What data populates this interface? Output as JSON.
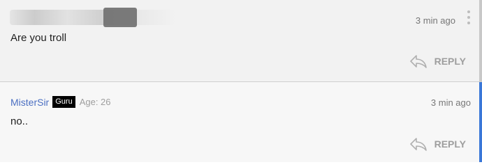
{
  "comments": [
    {
      "timestamp": "3 min ago",
      "text": "Are you troll",
      "reply_label": "REPLY",
      "icons": {
        "more": "more-vertical-icon",
        "reply": "reply-arrow-icon"
      }
    },
    {
      "username": "MisterSir",
      "badge": "Guru",
      "age": "Age: 26",
      "timestamp": "3 min ago",
      "text": "no..",
      "reply_label": "REPLY",
      "icons": {
        "reply": "reply-arrow-icon"
      }
    }
  ],
  "colors": {
    "username": "#4b6fc2",
    "badge_bg": "#000000",
    "active_border": "#3b78d8",
    "muted": "#9e9e9e"
  }
}
